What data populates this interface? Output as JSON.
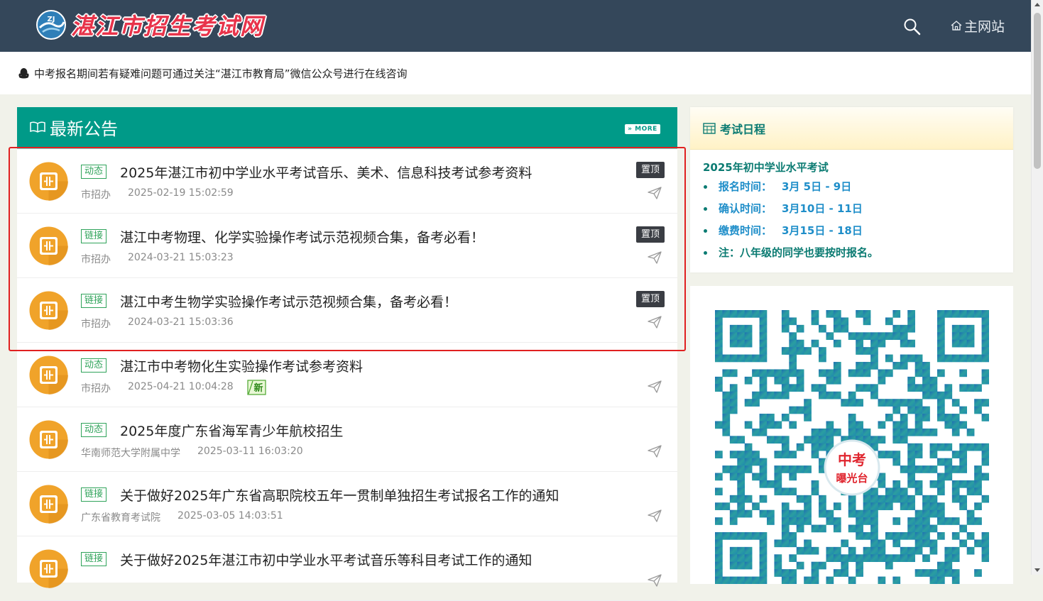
{
  "header": {
    "logo_text": "湛江市招生考试网",
    "home_label": "主网站"
  },
  "notice": {
    "text": "中考报名期间若有疑难问题可通过关注“湛江市教育局”微信公众号进行在线咨询"
  },
  "news": {
    "title": "最新公告",
    "more_label": "» MORE",
    "items": [
      {
        "tag": "动态",
        "title": "2025年湛江市初中学业水平考试音乐、美术、信息科技考试参考资料",
        "source": "市招办",
        "date": "2025-02-19 15:02:59",
        "pinned": "置顶"
      },
      {
        "tag": "链接",
        "title": "湛江中考物理、化学实验操作考试示范视频合集，备考必看！",
        "source": "市招办",
        "date": "2024-03-21 15:03:23",
        "pinned": "置顶"
      },
      {
        "tag": "链接",
        "title": "湛江中考生物学实验操作考试示范视频合集，备考必看！",
        "source": "市招办",
        "date": "2024-03-21 15:03:36",
        "pinned": "置顶"
      },
      {
        "tag": "动态",
        "title": "湛江市中考物化生实验操作考试参考资料",
        "source": "市招办",
        "date": "2025-04-21 10:04:28",
        "new_badge": "新"
      },
      {
        "tag": "动态",
        "title": "2025年度广东省海军青少年航校招生",
        "source": "华南师范大学附属中学",
        "date": "2025-03-11 16:03:20"
      },
      {
        "tag": "链接",
        "title": "关于做好2025年广东省高职院校五年一贯制单独招生考试报名工作的通知",
        "source": "广东省教育考试院",
        "date": "2025-03-05 14:03:51"
      },
      {
        "tag": "链接",
        "title": "关于做好2025年湛江市初中学业水平考试音乐等科目考试工作的通知",
        "source": "",
        "date": ""
      }
    ]
  },
  "schedule": {
    "title": "考试日程",
    "exam_name": "2025年初中学业水平考试",
    "rows": [
      {
        "label": "报名时间：",
        "value": "3月 5日 - 9日"
      },
      {
        "label": "确认时间：",
        "value": "3月10日 - 11日"
      },
      {
        "label": "缴费时间：",
        "value": "3月15日 - 18日"
      },
      {
        "label": "注：八年级的同学也要按时报名。",
        "value": ""
      }
    ]
  },
  "qr": {
    "center_line1": "中考",
    "center_line2": "曝光台"
  },
  "colors": {
    "header_bg": "#34475a",
    "accent": "#009a88",
    "tag_green": "#2fa35a",
    "logo_red": "#e8334a",
    "highlight": "#e02020"
  }
}
